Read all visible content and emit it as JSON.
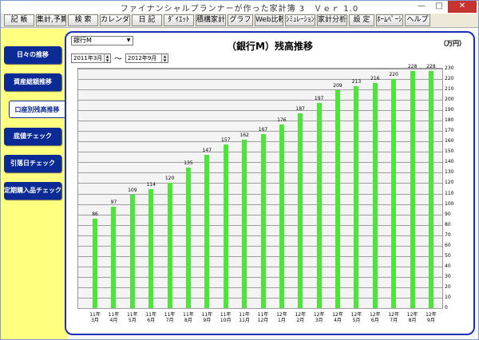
{
  "window": {
    "title": "ファイナンシャルプランナーが作った家計簿 3　Ｖｅｒ 1.0",
    "min_glyph": "—",
    "max_glyph": "□",
    "close_glyph": "✕"
  },
  "menu": [
    {
      "label": "記 帳",
      "w": 38
    },
    {
      "label": "集計,予算",
      "w": 38
    },
    {
      "label": "検 索",
      "w": 38
    },
    {
      "label": "カレンダー",
      "w": 38
    },
    {
      "label": "日 記",
      "w": 38
    },
    {
      "label": "ﾀﾞｲｴｯﾄ",
      "w": 38
    },
    {
      "label": "積構家計簿",
      "w": 38
    },
    {
      "label": "グラフ",
      "w": 32
    },
    {
      "label": "Web比較",
      "w": 36
    },
    {
      "label": "ｼﾐｭﾚｰｼｮﾝ",
      "w": 38
    },
    {
      "label": "家計分析",
      "w": 38
    },
    {
      "label": "設 定",
      "w": 32
    },
    {
      "label": "ﾎｰﾑﾍﾟｰｼﾞ",
      "w": 34
    },
    {
      "label": "ヘルプ",
      "w": 32
    }
  ],
  "sidebar": [
    {
      "label": "日々の推移"
    },
    {
      "label": "資産総額推移"
    },
    {
      "label": "口座別残高推移"
    },
    {
      "label": "底値チェック"
    },
    {
      "label": "引落日チェック"
    },
    {
      "label": "定期購入品チェック"
    }
  ],
  "controls": {
    "account": "銀行M",
    "date_from": "2011年3月",
    "date_to": "2012年9月",
    "tilde": "～"
  },
  "chart_data": {
    "type": "bar",
    "title": "（銀行M）残高推移",
    "unit": "（万円）",
    "categories": [
      "11年\n3月",
      "11年\n4月",
      "11年\n5月",
      "11年\n6月",
      "11年\n7月",
      "11年\n8月",
      "11年\n9月",
      "11年\n10月",
      "11年\n11月",
      "11年\n12月",
      "12年\n1月",
      "12年\n2月",
      "12年\n3月",
      "12年\n4月",
      "12年\n5月",
      "12年\n6月",
      "12年\n7月",
      "12年\n8月",
      "12年\n9月"
    ],
    "values": [
      86,
      97,
      109,
      114,
      120,
      135,
      147,
      157,
      162,
      167,
      176,
      187,
      197,
      209,
      213,
      216,
      220,
      228,
      228
    ],
    "ylim": [
      0,
      230
    ],
    "ytick_step": 10,
    "grid": true,
    "y_axis_position": "right",
    "bar_color": "#4de43c"
  }
}
